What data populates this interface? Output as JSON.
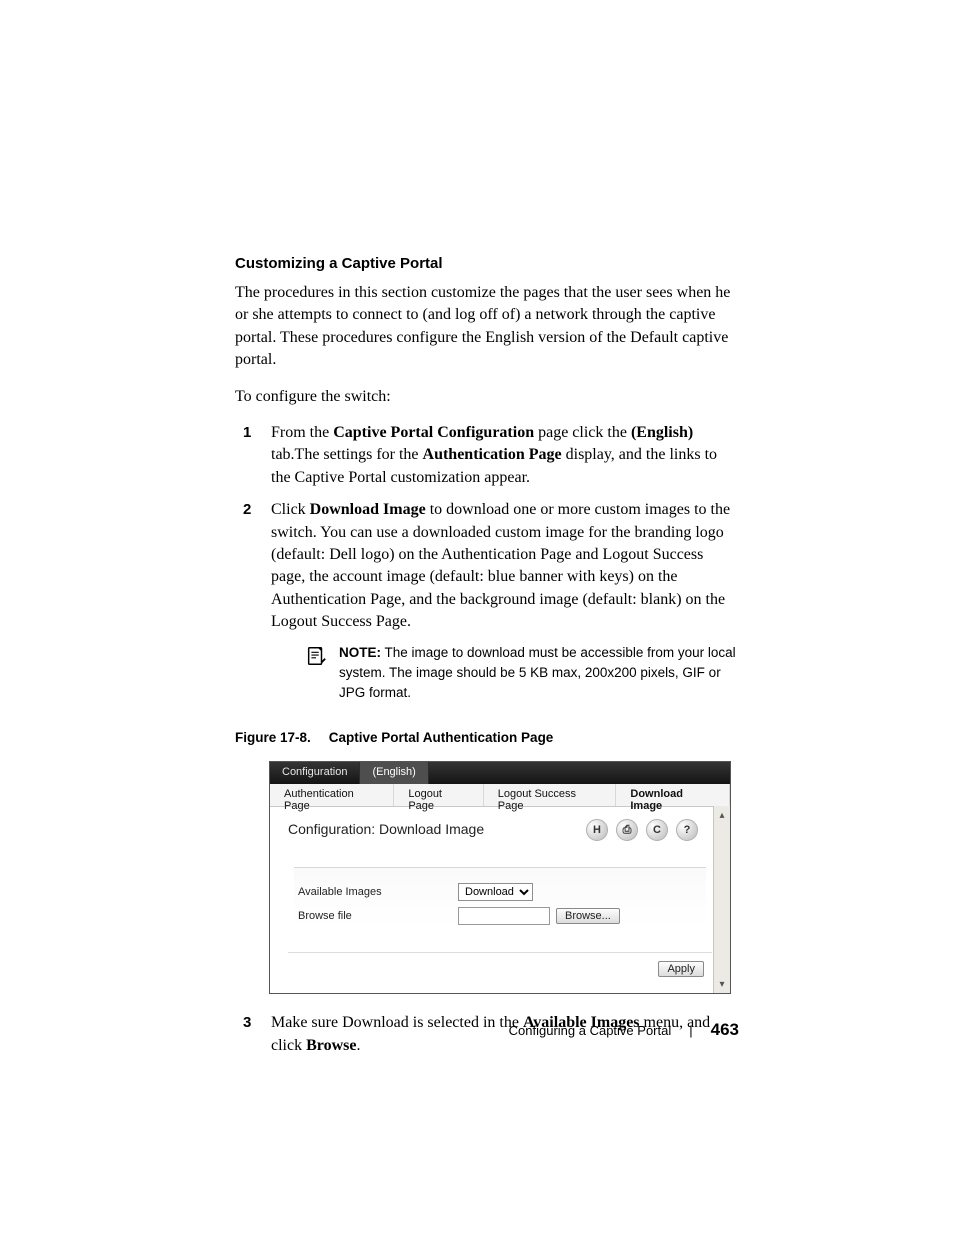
{
  "heading": "Customizing a Captive Portal",
  "intro": "The procedures in this section customize the pages that the user sees when he or she attempts to connect to (and log off of) a network through the captive portal. These procedures configure the English version of the Default captive portal.",
  "lead": "To configure the switch:",
  "steps": {
    "s1": {
      "num": "1",
      "pre": "From the ",
      "b1": "Captive Portal Configuration",
      "mid1": " page click the ",
      "b2": "(English)",
      "mid2": " tab.The settings for the ",
      "b3": "Authentication Page",
      "post": " display, and the links to the Captive Portal customization appear."
    },
    "s2": {
      "num": "2",
      "pre": "Click ",
      "b1": "Download Image",
      "post": " to download one or more custom images to the switch. You can use a downloaded custom image for the branding logo (default: Dell logo) on the Authentication Page and Logout Success page, the account image (default: blue banner with keys) on the Authentication Page, and the background image (default: blank) on the Logout Success Page."
    },
    "s3": {
      "num": "3",
      "pre": "Make sure Download is selected in the ",
      "b1": "Available Images",
      "mid": " menu, and click ",
      "b2": "Browse",
      "post": "."
    }
  },
  "note": {
    "label": "NOTE:",
    "text": " The image to download must be accessible from your local system. The image should be 5 KB max, 200x200 pixels, GIF or JPG format."
  },
  "figure": {
    "ref": "Figure 17-8.",
    "title": "Captive Portal Authentication Page"
  },
  "shot": {
    "tabs1": {
      "a": "Configuration",
      "b": "(English)"
    },
    "tabs2": {
      "a": "Authentication Page",
      "b": "Logout Page",
      "c": "Logout Success Page",
      "d": "Download Image"
    },
    "panel_title": "Configuration: Download Image",
    "icons": {
      "save": "H",
      "print": "⎙",
      "refresh": "C",
      "help": "?"
    },
    "row1_label": "Available Images",
    "row1_value": "Download",
    "row2_label": "Browse file",
    "browse_btn": "Browse...",
    "apply_btn": "Apply"
  },
  "footer": {
    "section": "Configuring a Captive Portal",
    "page": "463"
  }
}
